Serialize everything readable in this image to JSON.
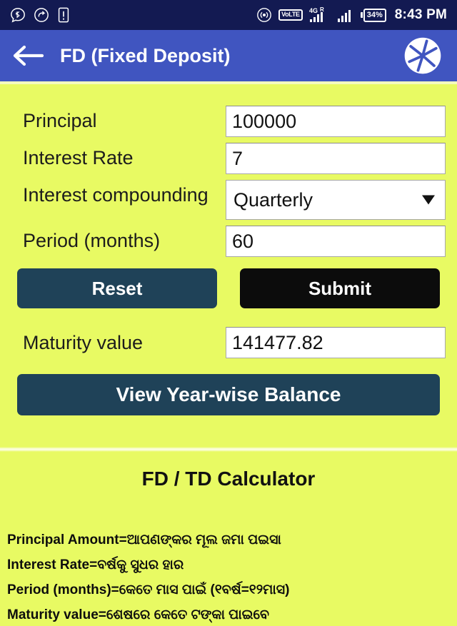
{
  "status_bar": {
    "icons_left": [
      "bluetooth-message-icon",
      "data-saver-icon",
      "sim-alert-icon"
    ],
    "icons_right": [
      "hotspot-icon",
      "volte-icon",
      "signal-4g-icon",
      "signal-bars-icon"
    ],
    "volte_label": "VoLTE",
    "network_label": "4G",
    "roaming_label": "R",
    "battery_percent": "34%",
    "time": "8:43 PM",
    "background_color": "#131a52"
  },
  "app_bar": {
    "back_icon": "back-arrow-icon",
    "title": "FD (Fixed Deposit)",
    "action_icon": "camera-aperture-icon",
    "background_color": "#4055c0"
  },
  "form": {
    "fields": [
      {
        "label": "Principal",
        "value": "100000",
        "type": "text"
      },
      {
        "label": "Interest Rate",
        "value": "7",
        "type": "text"
      },
      {
        "label": "Interest compounding",
        "value": "Quarterly",
        "type": "select"
      },
      {
        "label": "Period (months)",
        "value": "60",
        "type": "text"
      }
    ],
    "compounding_options": [
      "Quarterly"
    ],
    "buttons": {
      "reset": "Reset",
      "submit": "Submit",
      "view_yearwise": "View Year-wise Balance"
    },
    "result": {
      "label": "Maturity value",
      "value": "141477.82"
    },
    "background_color": "#e8fa63"
  },
  "info": {
    "title": "FD / TD Calculator",
    "lines": [
      "Principal Amount=ଆପଣଙ୍କର ମୂଲ ଜମା ପଇସା",
      "Interest Rate=ବର୍ଷକୁ ସୁଧର ହାର",
      "Period (months)=କେତେ ମାସ ପାଇଁ (୧ବର୍ଷ=୧୨ମାସ)",
      "Maturity value=ଶେଷରେ କେତେ ଟଙ୍କା ପାଇବେ"
    ]
  }
}
